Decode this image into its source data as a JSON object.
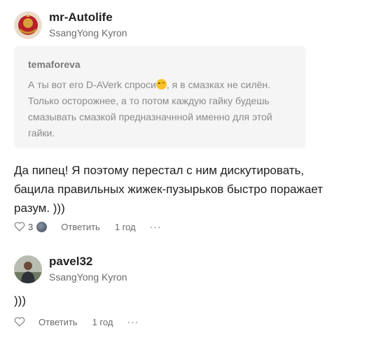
{
  "comments": [
    {
      "username": "mr-Autolife",
      "car": "SsangYong Kyron",
      "quote": {
        "author": "temaforeva",
        "text_before_emoji": "А ты вот его D-AVerk спроси",
        "text_after_emoji": ", я в смазках не силён. Только осторожнее, а то потом каждую гайку будешь смазывать смазкой предназначнной именно для этой гайки."
      },
      "text": "Да пипец! Я поэтому перестал с ним дискутировать, бацила правильных жижек-пузырьков быстро поражает разум. )))",
      "likes": "3",
      "reply_label": "Ответить",
      "time": "1 год",
      "more": "···"
    },
    {
      "username": "pavel32",
      "car": "SsangYong Kyron",
      "text": ")))",
      "reply_label": "Ответить",
      "time": "1 год",
      "more": "···"
    }
  ],
  "colors": {
    "quote_bg": "#f5f5f5",
    "meta_text": "#6b6b6b"
  },
  "icons": [
    "heart-icon",
    "more-icon",
    "smile-emoji-icon"
  ]
}
